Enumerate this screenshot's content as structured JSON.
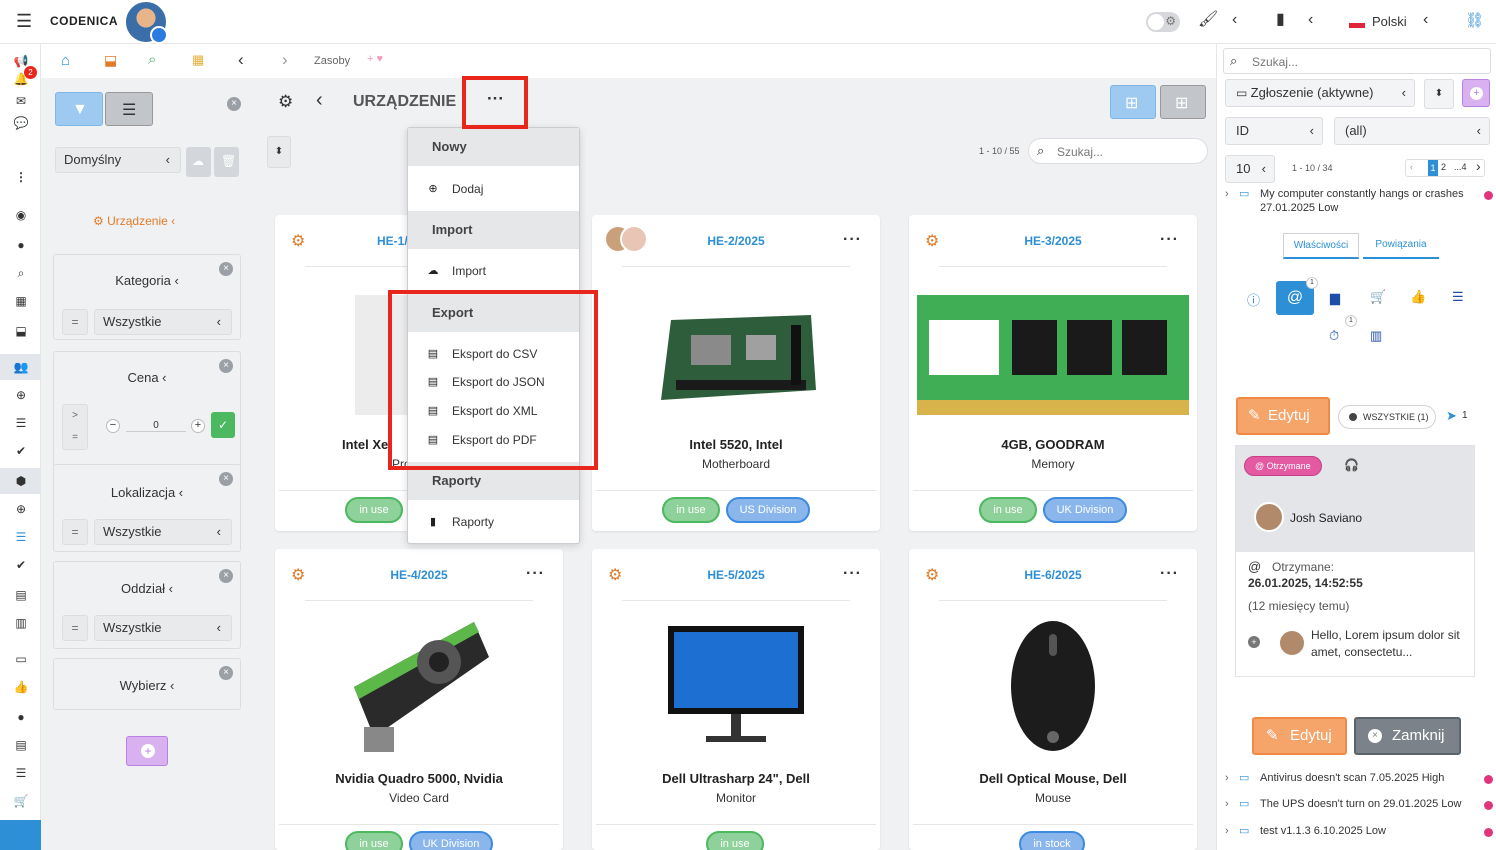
{
  "app": {
    "brand": "CODENICA",
    "language": "Polski"
  },
  "breadcrumb": {
    "current": "Zasoby"
  },
  "rail": {
    "notification_count": "2"
  },
  "filters": {
    "preset": "Domyślny",
    "category_label": "Urządzenie",
    "groups": [
      {
        "title": "Kategoria",
        "value": "Wszystkie",
        "op": "="
      },
      {
        "title": "Cena",
        "op_gt": ">",
        "op_eq": "=",
        "value": "0"
      },
      {
        "title": "Lokalizacja",
        "value": "Wszystkie",
        "op": "="
      },
      {
        "title": "Oddział",
        "value": "Wszystkie",
        "op": "="
      },
      {
        "title": "Wybierz"
      }
    ]
  },
  "main": {
    "title": "URZĄDZENIE",
    "pagination": "1 - 10 / 55",
    "search_placeholder": "Szukaj...",
    "cards": [
      {
        "code": "HE-1/",
        "name": "Intel Xe",
        "type": "Pro",
        "tags": [
          "in use"
        ]
      },
      {
        "code": "HE-2/2025",
        "name": "Intel 5520, Intel",
        "type": "Motherboard",
        "tags": [
          "in use",
          "US Division"
        ]
      },
      {
        "code": "HE-3/2025",
        "name": "4GB, GOODRAM",
        "type": "Memory",
        "tags": [
          "in use",
          "UK Division"
        ]
      },
      {
        "code": "HE-4/2025",
        "name": "Nvidia Quadro 5000, Nvidia",
        "type": "Video Card",
        "tags": [
          "in use",
          "UK Division"
        ]
      },
      {
        "code": "HE-5/2025",
        "name": "Dell Ultrasharp 24\", Dell",
        "type": "Monitor",
        "tags": [
          "in use"
        ]
      },
      {
        "code": "HE-6/2025",
        "name": "Dell Optical Mouse, Dell",
        "type": "Mouse",
        "tags": [
          "in stock"
        ]
      }
    ]
  },
  "menu": {
    "sections": [
      {
        "header": "Nowy",
        "items": [
          {
            "label": "Dodaj",
            "icon": "plus-circle-icon"
          }
        ]
      },
      {
        "header": "Import",
        "items": [
          {
            "label": "Import",
            "icon": "cloud-upload-icon"
          }
        ]
      },
      {
        "header": "Export",
        "items": [
          {
            "label": "Eksport do CSV",
            "icon": "file-csv-icon"
          },
          {
            "label": "Eksport do JSON",
            "icon": "file-json-icon"
          },
          {
            "label": "Eksport do XML",
            "icon": "file-xml-icon"
          },
          {
            "label": "Eksport do PDF",
            "icon": "file-pdf-icon"
          }
        ]
      },
      {
        "header": "Raporty",
        "items": [
          {
            "label": "Raporty",
            "icon": "bar-chart-icon"
          }
        ]
      }
    ]
  },
  "right": {
    "search_placeholder": "Szukaj...",
    "ticket_type": "Zgłoszenie (aktywne)",
    "field": "ID",
    "field_value": "(all)",
    "page_size": "10",
    "pagination": "1 - 10 / 34",
    "pages": [
      "1",
      "2",
      "...4"
    ],
    "tickets_top": [
      {
        "text": "My computer constantly hangs or crashes 27.01.2025 Low"
      }
    ],
    "tabs": [
      "Właściwości",
      "Powiązania"
    ],
    "edit_label": "Edytuj",
    "filter_all": "WSZYSTKIE (1)",
    "send_count": "1",
    "badge_count_1": "1",
    "badge_count_2": "1",
    "received_pill": "Otrzymane",
    "sender": "Josh Saviano",
    "received_label": "Otrzymane:",
    "received_date": "26.01.2025, 14:52:55",
    "received_ago": "(12 miesięcy temu)",
    "message": "Hello, Lorem ipsum dolor sit amet, consectetu...",
    "edit2_label": "Edytuj",
    "close_label": "Zamknij",
    "tickets_bottom": [
      {
        "text": "Antivirus doesn't scan 7.05.2025 High"
      },
      {
        "text": "The UPS doesn't turn on 29.01.2025 Low"
      },
      {
        "text": "test v1.1.3 6.10.2025 Low"
      }
    ]
  },
  "colors": {
    "accent": "#2d8fd5",
    "chip": "#e07b2a",
    "highlight": "#e8261c",
    "edit": "#f5a46a",
    "tag_green": "#4cb860",
    "tag_blue": "#3d8be0"
  }
}
